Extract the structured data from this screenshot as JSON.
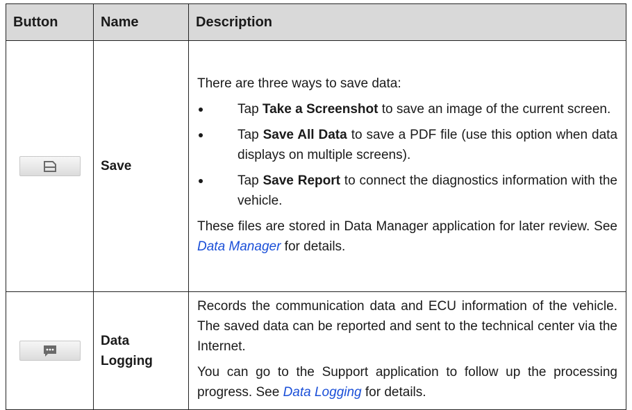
{
  "table": {
    "headers": {
      "button": "Button",
      "name": "Name",
      "description": "Description"
    },
    "rows": [
      {
        "icon": "save-icon",
        "name": "Save",
        "intro": "There are three ways to save data:",
        "bullets": [
          {
            "pre": "Tap ",
            "bold": "Take a Screenshot",
            "post": " to save an image of the current screen."
          },
          {
            "pre": "Tap ",
            "bold": "Save All Data",
            "post": " to save a PDF file (use this option when data displays on multiple screens)."
          },
          {
            "pre": "Tap ",
            "bold": "Save Report",
            "post": " to connect the diagnostics information with the vehicle."
          }
        ],
        "outro_pre": "These files are stored in Data Manager application for later review. See ",
        "outro_link": "Data Manager",
        "outro_post": " for details."
      },
      {
        "icon": "data-logging-icon",
        "name_line1": "Data",
        "name_line2": "Logging",
        "para1": "Records the communication data and ECU information of the vehicle. The saved data can be reported and sent to the technical center via the Internet.",
        "para2_pre": "You can go to the Support application to follow up the processing progress. See ",
        "para2_link": "Data Logging",
        "para2_post": " for details."
      }
    ]
  },
  "colors": {
    "header_bg": "#d9d9d9",
    "link": "#1a4fd8",
    "icon": "#6a6a6a"
  }
}
